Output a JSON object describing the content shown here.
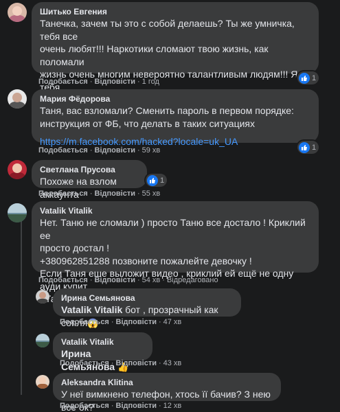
{
  "actions": {
    "like": "Подобається",
    "reply": "Відповісти",
    "edited": "Відредаговано"
  },
  "comments": [
    {
      "name": "Шитько Евгения",
      "text": "Танечка, зачем ты это с собой делаешь? Ты же умничка, тебя все\nочень любят!!! Наркотики сломают твою жизнь, как поломали\nжизнь очень многим невероятно талантливым людям!!! Я тебя\nочень прошу - найди в себе силы прекратить принимать эту дурь!!!\nЭта гадость разрушает твоё сознание...",
      "time": "1 год",
      "reactions": "1"
    },
    {
      "name": "Мария Фёдорова",
      "text": "Таня, вас взломали? Сменить пароль в первом порядке:\nинструкция от ФБ, что делать в таких ситуациях",
      "link": "https://m.facebook.com/hacked?locale=uk_UA",
      "time": "59 хв",
      "reactions": "1"
    },
    {
      "name": "Светлана Прусова",
      "text": "Похоже на взлом аккаунта",
      "time": "55 хв",
      "reactions": "1"
    },
    {
      "name": "Vatalik Vitalik",
      "text": "Нет. Таню не сломали ) просто Таню все достало ! Криклий ее\nпросто достал !\n+380962851288 позвоните пожалейте девочку !\nЕсли Таня еше выложит видео , криклий ей ещё не одну ауди купит\n! Таня давай !!",
      "time": "54 хв"
    }
  ],
  "replies": [
    {
      "name": "Ирина Семьянова",
      "mention": "Vatalik Vitalik",
      "text": " бот , прозрачный как сопля",
      "emoji": "😱",
      "time": "47 хв"
    },
    {
      "name": "Vatalik Vitalik",
      "mention": "Ирина Семьянова",
      "emoji": "👍",
      "time": "43 хв"
    },
    {
      "name": "Aleksandra Klitina",
      "text": "У неї вимкнено телефон, хтось її бачив? З нею все ок?",
      "time": "12 хв"
    }
  ],
  "colors": {
    "background": "#1a1b1c",
    "bubble": "#3a3b3c",
    "link": "#4599ff",
    "like": "#1877f2"
  }
}
